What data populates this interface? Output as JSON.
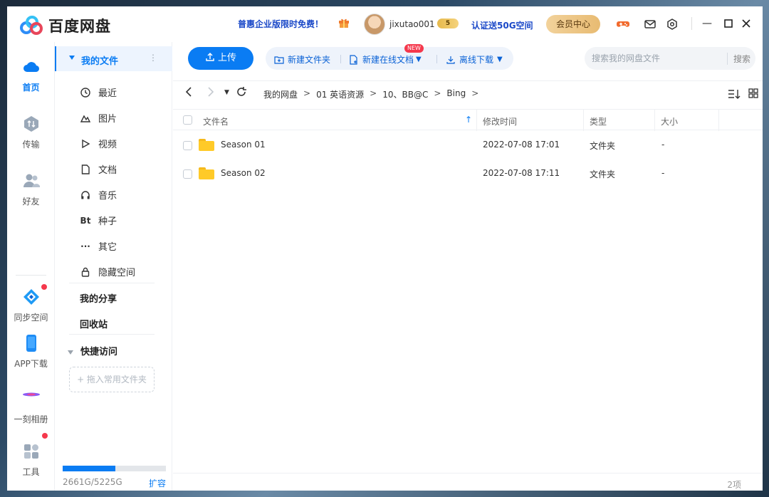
{
  "app": {
    "title": "百度网盘",
    "promo": "普惠企业版限时免费！",
    "username": "jixutao001",
    "vip_level": "5",
    "verify": "认证送50G空间",
    "vip_center": "会员中心"
  },
  "colors": {
    "accent": "#0a7cf3",
    "promo": "#1b49c8",
    "red_dot": "#f5384c",
    "folder": "#ffca28"
  },
  "leftnav": {
    "home": "首页",
    "transfer": "传输",
    "friends": "好友",
    "sync": "同步空间",
    "app_download": "APP下载",
    "album": "一刻相册",
    "tools": "工具"
  },
  "sidebar": {
    "my_files": "我的文件",
    "more": "⋮",
    "items": [
      {
        "label": "最近",
        "icon": "clock-icon"
      },
      {
        "label": "图片",
        "icon": "picture-icon"
      },
      {
        "label": "视频",
        "icon": "play-icon"
      },
      {
        "label": "文档",
        "icon": "document-icon"
      },
      {
        "label": "音乐",
        "icon": "headphones-icon"
      },
      {
        "label": "种子",
        "icon": "bt-icon",
        "glyph": "Bt"
      },
      {
        "label": "其它",
        "icon": "ellipsis-icon",
        "glyph": "···"
      },
      {
        "label": "隐藏空间",
        "icon": "lock-icon"
      }
    ],
    "my_share": "我的分享",
    "recycle": "回收站",
    "quick_access": "快捷访问",
    "drag_hint": "+ 拖入常用文件夹",
    "quota_text": "2661G/5225G",
    "quota_fraction": 0.509,
    "expand": "扩容"
  },
  "toolbar": {
    "upload": "上传",
    "new_folder": "新建文件夹",
    "new_doc": "新建在线文档",
    "new_badge": "NEW",
    "offline": "离线下载",
    "search_placeholder": "搜索我的网盘文件",
    "search_btn": "搜索"
  },
  "breadcrumb": [
    "我的网盘",
    "01 英语资源",
    "10、BB@C",
    "Bing"
  ],
  "table": {
    "headers": {
      "name": "文件名",
      "modified": "修改时间",
      "type": "类型",
      "size": "大小"
    },
    "rows": [
      {
        "name": "Season 01",
        "modified": "2022-07-08 17:01",
        "type": "文件夹",
        "size": "-"
      },
      {
        "name": "Season 02",
        "modified": "2022-07-08 17:11",
        "type": "文件夹",
        "size": "-"
      }
    ]
  },
  "footer": {
    "count": "2项"
  }
}
